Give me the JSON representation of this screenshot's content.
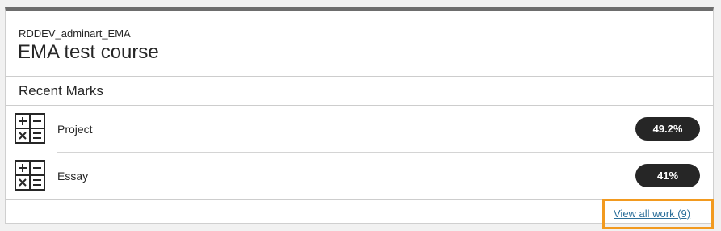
{
  "course": {
    "id": "RDDEV_adminart_EMA",
    "name": "EMA test course"
  },
  "recent_marks": {
    "title": "Recent Marks",
    "items": [
      {
        "label": "Project",
        "mark": "49.2%",
        "icon": "calculator-operations-icon"
      },
      {
        "label": "Essay",
        "mark": "41%",
        "icon": "calculator-operations-icon"
      }
    ]
  },
  "footer": {
    "view_all_label": "View all work (9)"
  },
  "colors": {
    "card_top_border": "#6d6d6d",
    "pill_background": "#262626",
    "link": "#2c6f9a",
    "focus_highlight": "#f29a1f"
  }
}
